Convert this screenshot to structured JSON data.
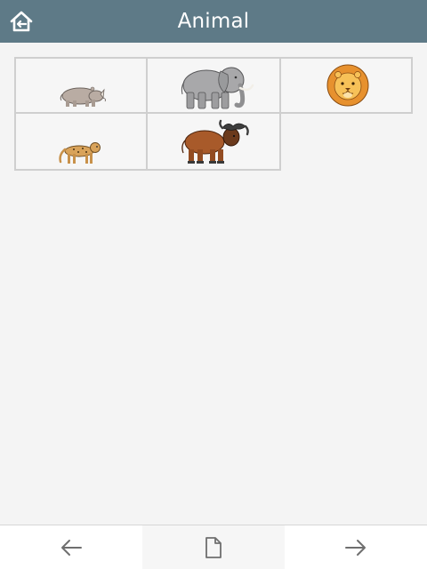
{
  "header": {
    "title": "Animal",
    "home_icon": "home-back-icon"
  },
  "grid": {
    "cells": [
      {
        "name": "rhinoceros"
      },
      {
        "name": "elephant"
      },
      {
        "name": "lion"
      },
      {
        "name": "cheetah"
      },
      {
        "name": "buffalo"
      }
    ]
  },
  "footer": {
    "prev_icon": "arrow-left-icon",
    "document_icon": "document-icon",
    "next_icon": "arrow-right-icon"
  },
  "colors": {
    "header_bg": "#5e7a87",
    "page_bg": "#f4f4f4",
    "cell_border": "#cfcfcf"
  }
}
